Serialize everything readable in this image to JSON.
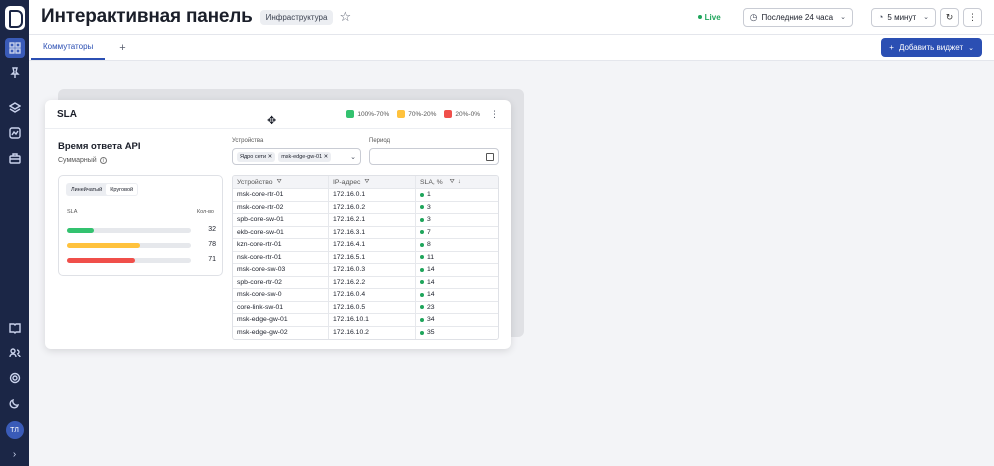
{
  "header": {
    "title": "Интерактивная панель",
    "tag": "Инфраструктура",
    "live": "Live",
    "time_range": "Последние 24 часа",
    "refresh_interval": "5 минут"
  },
  "tabs": [
    {
      "label": "Коммутаторы"
    }
  ],
  "add_widget_label": "Добавить виджет",
  "sidebar": {
    "avatar": "ТЛ"
  },
  "widget": {
    "title": "SLA",
    "legend": [
      {
        "label": "100%-70%",
        "color": "#33c26f"
      },
      {
        "label": "70%-20%",
        "color": "#ffc23d"
      },
      {
        "label": "20%-0%",
        "color": "#f04f4a"
      }
    ],
    "api_title": "Время ответа API",
    "summary": "Суммарный",
    "chart": {
      "tabs": [
        "Линейчатый",
        "Круговой"
      ],
      "active_tab": "Круговой",
      "sla_label": "SLA",
      "count_label": "Кол-во",
      "bars": [
        {
          "value": 32,
          "fill": 0.22,
          "color": "#33c26f"
        },
        {
          "value": 78,
          "fill": 0.59,
          "color": "#ffc23d"
        },
        {
          "value": 71,
          "fill": 0.55,
          "color": "#f04f4a"
        }
      ]
    },
    "devices_label": "Устройства",
    "device_chips": [
      "Ядро сети",
      "msk-edge-gw-01"
    ],
    "period_label": "Период",
    "table": {
      "columns": [
        "Устройство",
        "IP-адрес",
        "SLA, %"
      ],
      "rows": [
        [
          "msk-core-rtr-01",
          "172.16.0.1",
          "1"
        ],
        [
          "msk-core-rtr-02",
          "172.16.0.2",
          "3"
        ],
        [
          "spb-core-sw-01",
          "172.16.2.1",
          "3"
        ],
        [
          "ekb-core-sw-01",
          "172.16.3.1",
          "7"
        ],
        [
          "kzn-core-rtr-01",
          "172.16.4.1",
          "8"
        ],
        [
          "nsk-core-rtr-01",
          "172.16.5.1",
          "11"
        ],
        [
          "msk-core-sw-03",
          "172.16.0.3",
          "14"
        ],
        [
          "spb-core-rtr-02",
          "172.16.2.2",
          "14"
        ],
        [
          "msk-core-sw-0",
          "172.16.0.4",
          "14"
        ],
        [
          "core-link-sw-01",
          "172.16.0.5",
          "23"
        ],
        [
          "msk-edge-gw-01",
          "172.16.10.1",
          "34"
        ],
        [
          "msk-edge-gw-02",
          "172.16.10.2",
          "35"
        ]
      ]
    }
  }
}
